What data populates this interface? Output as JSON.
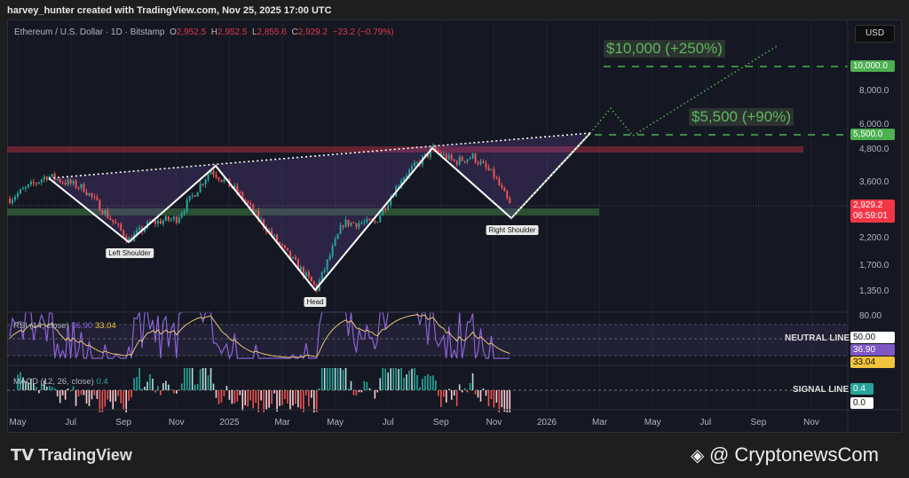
{
  "header": {
    "credit": "harvey_hunter created with TradingView.com, Nov 25, 2025 17:00 UTC"
  },
  "legend": {
    "symbol": "Ethereum / U.S. Dollar · 1D · Bitstamp",
    "o_label": "O",
    "o": "2,952.5",
    "h_label": "H",
    "h": "2,952.5",
    "l_label": "L",
    "l": "2,855.6",
    "c_label": "C",
    "c": "2,929.2",
    "change": "−23.2 (−0.79%)"
  },
  "currency": "USD",
  "price_axis": [
    "8,000.0",
    "6,000.0",
    "4,800.0",
    "3,600.0",
    "2,200.0",
    "1,700.0",
    "1,350.0",
    "80.00"
  ],
  "tags": {
    "target1": "10,000.0",
    "target2": "5,500.0",
    "last_price": "2,929.2",
    "countdown": "06:59:01",
    "rsi_neutral": "50.00",
    "rsi_value": "36.90",
    "rsi_ma": "33.04",
    "macd_value": "0.4",
    "macd_zero": "0.0"
  },
  "annotations": {
    "target1": "$10,000 (+250%)",
    "target2": "$5,500 (+90%)",
    "left_shoulder": "Left Shoulder",
    "head": "Head",
    "right_shoulder": "Right Shoulder",
    "neutral_line": "NEUTRAL LINE",
    "signal_line": "SIGNAL LINE"
  },
  "rsi": {
    "label": "RSI (14, close)",
    "value": "36.90",
    "ma": "33.04"
  },
  "macd": {
    "label": "MACD (12, 26, close)",
    "value": "0.4"
  },
  "footer": {
    "brand": "TradingView",
    "source": "@ CryptonewsCom"
  },
  "colors": {
    "up": "#26a69a",
    "down": "#ef5350",
    "target": "#4caf50",
    "last": "#f23645",
    "rsi": "#7e57c2",
    "rsi_ma": "#e6c47a"
  },
  "chart_data": {
    "type": "candlestick",
    "title": "Ethereum / U.S. Dollar · 1D · Bitstamp",
    "scale": "log",
    "ylim": [
      1250,
      12500
    ],
    "x_ticks": [
      "May",
      "Jul",
      "Sep",
      "Nov",
      "2025",
      "Mar",
      "May",
      "Jul",
      "Sep",
      "Nov",
      "2026",
      "Mar",
      "May",
      "Jul",
      "Sep",
      "Nov"
    ],
    "price_path": [
      [
        -0.3,
        3100
      ],
      [
        1.1,
        3800
      ],
      [
        2.5,
        3400
      ],
      [
        4.2,
        2150
      ],
      [
        5,
        2500
      ],
      [
        6,
        2600
      ],
      [
        7.3,
        4000
      ],
      [
        8.3,
        3300
      ],
      [
        10,
        2000
      ],
      [
        11.3,
        1400
      ],
      [
        12.3,
        2500
      ],
      [
        13.5,
        2500
      ],
      [
        14.5,
        3700
      ],
      [
        15.7,
        4800
      ],
      [
        16.5,
        4300
      ],
      [
        17.2,
        4500
      ],
      [
        18,
        3800
      ],
      [
        18.6,
        2930
      ]
    ],
    "pattern": {
      "left_shoulder": [
        3.5,
        2100
      ],
      "head": [
        11.2,
        1400
      ],
      "right_shoulder": [
        18.7,
        2650
      ],
      "neckline_start": [
        1.2,
        3800
      ],
      "neckline_end": [
        21.5,
        5500
      ]
    },
    "projection": [
      [
        18.7,
        2650
      ],
      [
        21.5,
        5500
      ],
      [
        22.3,
        6900
      ],
      [
        23,
        5500
      ],
      [
        28.8,
        10500
      ]
    ],
    "levels": {
      "resistance": 4800,
      "support": 2700,
      "target1": 10000,
      "target2": 5500
    }
  }
}
